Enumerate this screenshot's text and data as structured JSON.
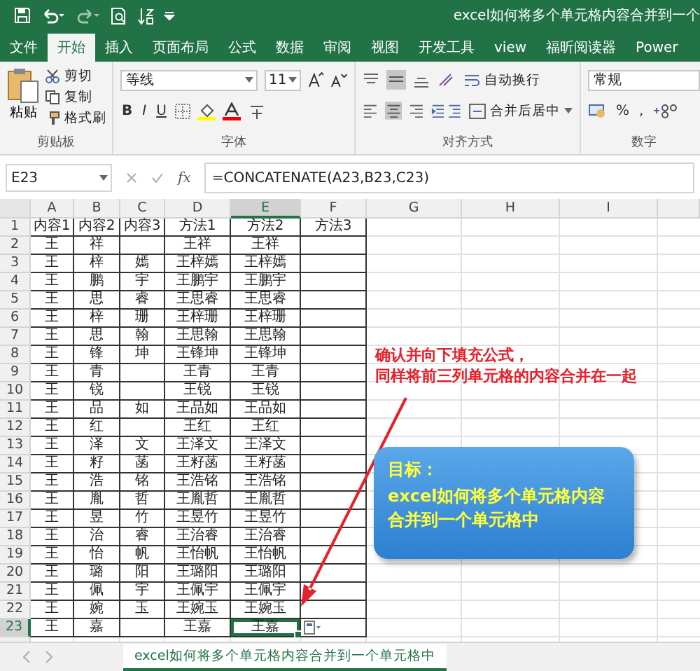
{
  "window": {
    "title": "excel如何将多个单元格内容合并到一个"
  },
  "menu_tabs": [
    {
      "label": "文件",
      "selected": false
    },
    {
      "label": "开始",
      "selected": true
    },
    {
      "label": "插入",
      "selected": false
    },
    {
      "label": "页面布局",
      "selected": false
    },
    {
      "label": "公式",
      "selected": false
    },
    {
      "label": "数据",
      "selected": false
    },
    {
      "label": "审阅",
      "selected": false
    },
    {
      "label": "视图",
      "selected": false
    },
    {
      "label": "开发工具",
      "selected": false
    },
    {
      "label": "view",
      "selected": false
    },
    {
      "label": "福昕阅读器",
      "selected": false
    },
    {
      "label": "Power",
      "selected": false
    }
  ],
  "ribbon": {
    "clipboard": {
      "paste": "粘贴",
      "cut": "剪切",
      "copy": "复制",
      "format_painter": "格式刷",
      "label": "剪贴板"
    },
    "font": {
      "name": "等线",
      "size": "11",
      "bold": "B",
      "italic": "I",
      "underline": "U",
      "label": "字体"
    },
    "alignment": {
      "wrap": "自动换行",
      "merge": "合并后居中",
      "label": "对齐方式"
    },
    "number": {
      "format": "常规",
      "percent": "%",
      "comma": ",",
      "label": "数字"
    }
  },
  "formula_bar": {
    "name_box": "E23",
    "fx": "fx",
    "formula": "=CONCATENATE(A23,B23,C23)"
  },
  "sheet": {
    "columns": [
      {
        "label": "A",
        "selected": false
      },
      {
        "label": "B",
        "selected": false
      },
      {
        "label": "C",
        "selected": false
      },
      {
        "label": "D",
        "selected": false
      },
      {
        "label": "E",
        "selected": true
      },
      {
        "label": "F",
        "selected": false
      },
      {
        "label": "G",
        "selected": false
      },
      {
        "label": "H",
        "selected": false
      },
      {
        "label": "I",
        "selected": false
      }
    ],
    "rows": [
      {
        "number": "1",
        "selected": false,
        "cells": [
          "内容1",
          "内容2",
          "内容3",
          "方法1",
          "方法2",
          "方法3"
        ]
      },
      {
        "number": "2",
        "selected": false,
        "cells": [
          "王",
          "祥",
          null,
          "王祥",
          "王祥",
          null
        ]
      },
      {
        "number": "3",
        "selected": false,
        "cells": [
          "王",
          "梓",
          "嫣",
          "王梓嫣",
          "王梓嫣",
          null
        ]
      },
      {
        "number": "4",
        "selected": false,
        "cells": [
          "王",
          "鹏",
          "宇",
          "王鹏宇",
          "王鹏宇",
          null
        ]
      },
      {
        "number": "5",
        "selected": false,
        "cells": [
          "王",
          "思",
          "睿",
          "王思睿",
          "王思睿",
          null
        ]
      },
      {
        "number": "6",
        "selected": false,
        "cells": [
          "王",
          "梓",
          "珊",
          "王梓珊",
          "王梓珊",
          null
        ]
      },
      {
        "number": "7",
        "selected": false,
        "cells": [
          "王",
          "思",
          "翰",
          "王思翰",
          "王思翰",
          null
        ]
      },
      {
        "number": "8",
        "selected": false,
        "cells": [
          "王",
          "锋",
          "坤",
          "王锋坤",
          "王锋坤",
          null
        ]
      },
      {
        "number": "9",
        "selected": false,
        "cells": [
          "王",
          "青",
          null,
          "王青",
          "王青",
          null
        ]
      },
      {
        "number": "10",
        "selected": false,
        "cells": [
          "王",
          "锐",
          null,
          "王锐",
          "王锐",
          null
        ]
      },
      {
        "number": "11",
        "selected": false,
        "cells": [
          "王",
          "品",
          "如",
          "王品如",
          "王品如",
          null
        ]
      },
      {
        "number": "12",
        "selected": false,
        "cells": [
          "王",
          "红",
          null,
          "王红",
          "王红",
          null
        ]
      },
      {
        "number": "13",
        "selected": false,
        "cells": [
          "王",
          "泽",
          "文",
          "王泽文",
          "王泽文",
          null
        ]
      },
      {
        "number": "14",
        "selected": false,
        "cells": [
          "王",
          "籽",
          "菡",
          "王籽菡",
          "王籽菡",
          null
        ]
      },
      {
        "number": "15",
        "selected": false,
        "cells": [
          "王",
          "浩",
          "铭",
          "王浩铭",
          "王浩铭",
          null
        ]
      },
      {
        "number": "16",
        "selected": false,
        "cells": [
          "王",
          "胤",
          "哲",
          "王胤哲",
          "王胤哲",
          null
        ]
      },
      {
        "number": "17",
        "selected": false,
        "cells": [
          "王",
          "昱",
          "竹",
          "王昱竹",
          "王昱竹",
          null
        ]
      },
      {
        "number": "18",
        "selected": false,
        "cells": [
          "王",
          "治",
          "睿",
          "王治睿",
          "王治睿",
          null
        ]
      },
      {
        "number": "19",
        "selected": false,
        "cells": [
          "王",
          "怡",
          "帆",
          "王怡帆",
          "王怡帆",
          null
        ]
      },
      {
        "number": "20",
        "selected": false,
        "cells": [
          "王",
          "璐",
          "阳",
          "王璐阳",
          "王璐阳",
          null
        ]
      },
      {
        "number": "21",
        "selected": false,
        "cells": [
          "王",
          "佩",
          "宇",
          "王佩宇",
          "王佩宇",
          null
        ]
      },
      {
        "number": "22",
        "selected": false,
        "cells": [
          "王",
          "婉",
          "玉",
          "王婉玉",
          "王婉玉",
          null
        ]
      },
      {
        "number": "23",
        "selected": true,
        "cells": [
          "王",
          "嘉",
          null,
          "王嘉",
          "王嘉",
          null
        ]
      }
    ]
  },
  "sheet_tabs": [
    {
      "label": "excel如何将多个单元格内容合并到一个单元格中",
      "selected": true
    }
  ],
  "annotation": {
    "note_lines": [
      "确认并向下填充公式，",
      "同样将前三列单元格的内容合并在一起"
    ],
    "callout": {
      "title": "目标：",
      "text": "excel如何将多个单元格内容合并到一个单元格中"
    }
  }
}
